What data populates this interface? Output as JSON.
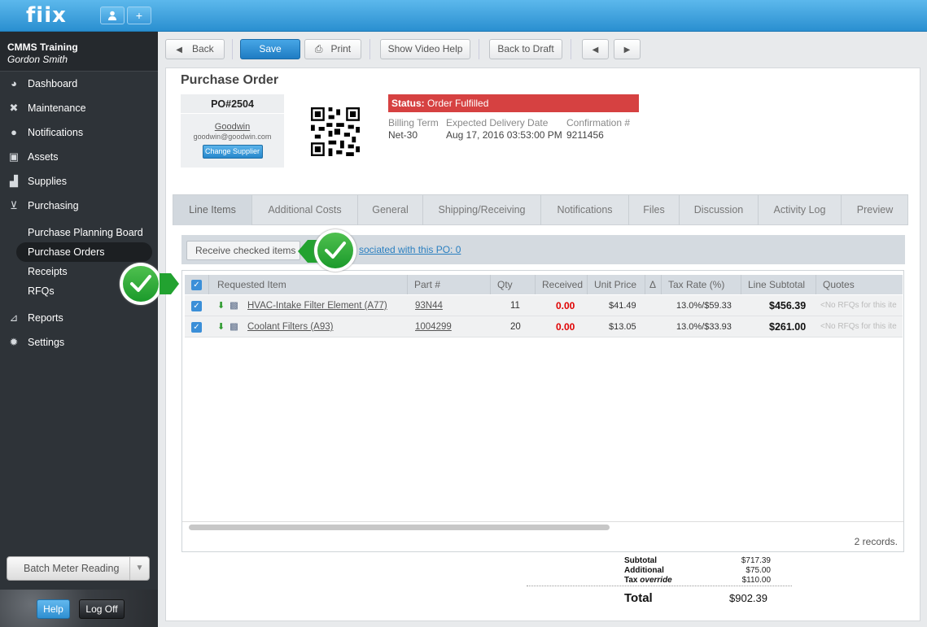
{
  "app": {
    "logo": "fiix"
  },
  "topbar": {
    "user_icon": "user-icon",
    "add_label": "+"
  },
  "account": {
    "name": "CMMS Training",
    "user": "Gordon Smith"
  },
  "nav": {
    "dashboard": "Dashboard",
    "maintenance": "Maintenance",
    "notifications": "Notifications",
    "assets": "Assets",
    "supplies": "Supplies",
    "purchasing": "Purchasing",
    "planning_board": "Purchase Planning Board",
    "purchase_orders": "Purchase Orders",
    "receipts": "Receipts",
    "rfqs": "RFQs",
    "reports": "Reports",
    "settings": "Settings"
  },
  "sidebar_footer": {
    "batch": "Batch Meter Reading",
    "help": "Help",
    "logoff": "Log Off"
  },
  "toolbar": {
    "back": "Back",
    "save": "Save",
    "print": "Print",
    "video": "Show Video Help",
    "draft": "Back to Draft"
  },
  "po": {
    "title": "Purchase Order",
    "number": "PO#2504",
    "supplier": "Goodwin",
    "supplier_email": "goodwin@goodwin.com",
    "change_supplier": "Change Supplier",
    "status_label": "Status:",
    "status_value": "Order Fulfilled",
    "billing_term_label": "Billing Term",
    "billing_term": "Net-30",
    "delivery_label": "Expected Delivery Date",
    "delivery": "Aug 17, 2016 03:53:00 PM",
    "confirmation_label": "Confirmation #",
    "confirmation": "9211456"
  },
  "tabs": [
    "Line Items",
    "Additional Costs",
    "General",
    "Shipping/Receiving",
    "Notifications",
    "Files",
    "Discussion",
    "Activity Log",
    "Preview"
  ],
  "actions": {
    "receive": "Receive checked items",
    "associated": "sociated with this PO: 0"
  },
  "grid": {
    "headers": [
      "Requested Item",
      "Part #",
      "Qty",
      "Received",
      "Unit Price",
      "Δ",
      "Tax Rate (%)",
      "Line Subtotal",
      "Quotes"
    ],
    "rows": [
      {
        "item": "HVAC-Intake Filter Element (A77)",
        "part": "93N44",
        "qty": "11",
        "received": "0.00",
        "unit": "$41.49",
        "tax": "13.0%/$59.33",
        "subtotal": "$456.39",
        "quotes": "<No RFQs for this ite"
      },
      {
        "item": "Coolant Filters (A93)",
        "part": "1004299",
        "qty": "20",
        "received": "0.00",
        "unit": "$13.05",
        "tax": "13.0%/$33.93",
        "subtotal": "$261.00",
        "quotes": "<No RFQs for this ite"
      }
    ],
    "records": "2 records."
  },
  "totals": {
    "subtotal_label": "Subtotal",
    "subtotal": "$717.39",
    "additional_label": "Additional",
    "additional": "$75.00",
    "tax_label": "Tax",
    "tax_override": "override",
    "tax": "$110.00",
    "total_label": "Total",
    "total": "$902.39"
  },
  "colors": {
    "accent": "#2a8fd0",
    "status": "#d64141",
    "check": "#1b9a2b"
  }
}
